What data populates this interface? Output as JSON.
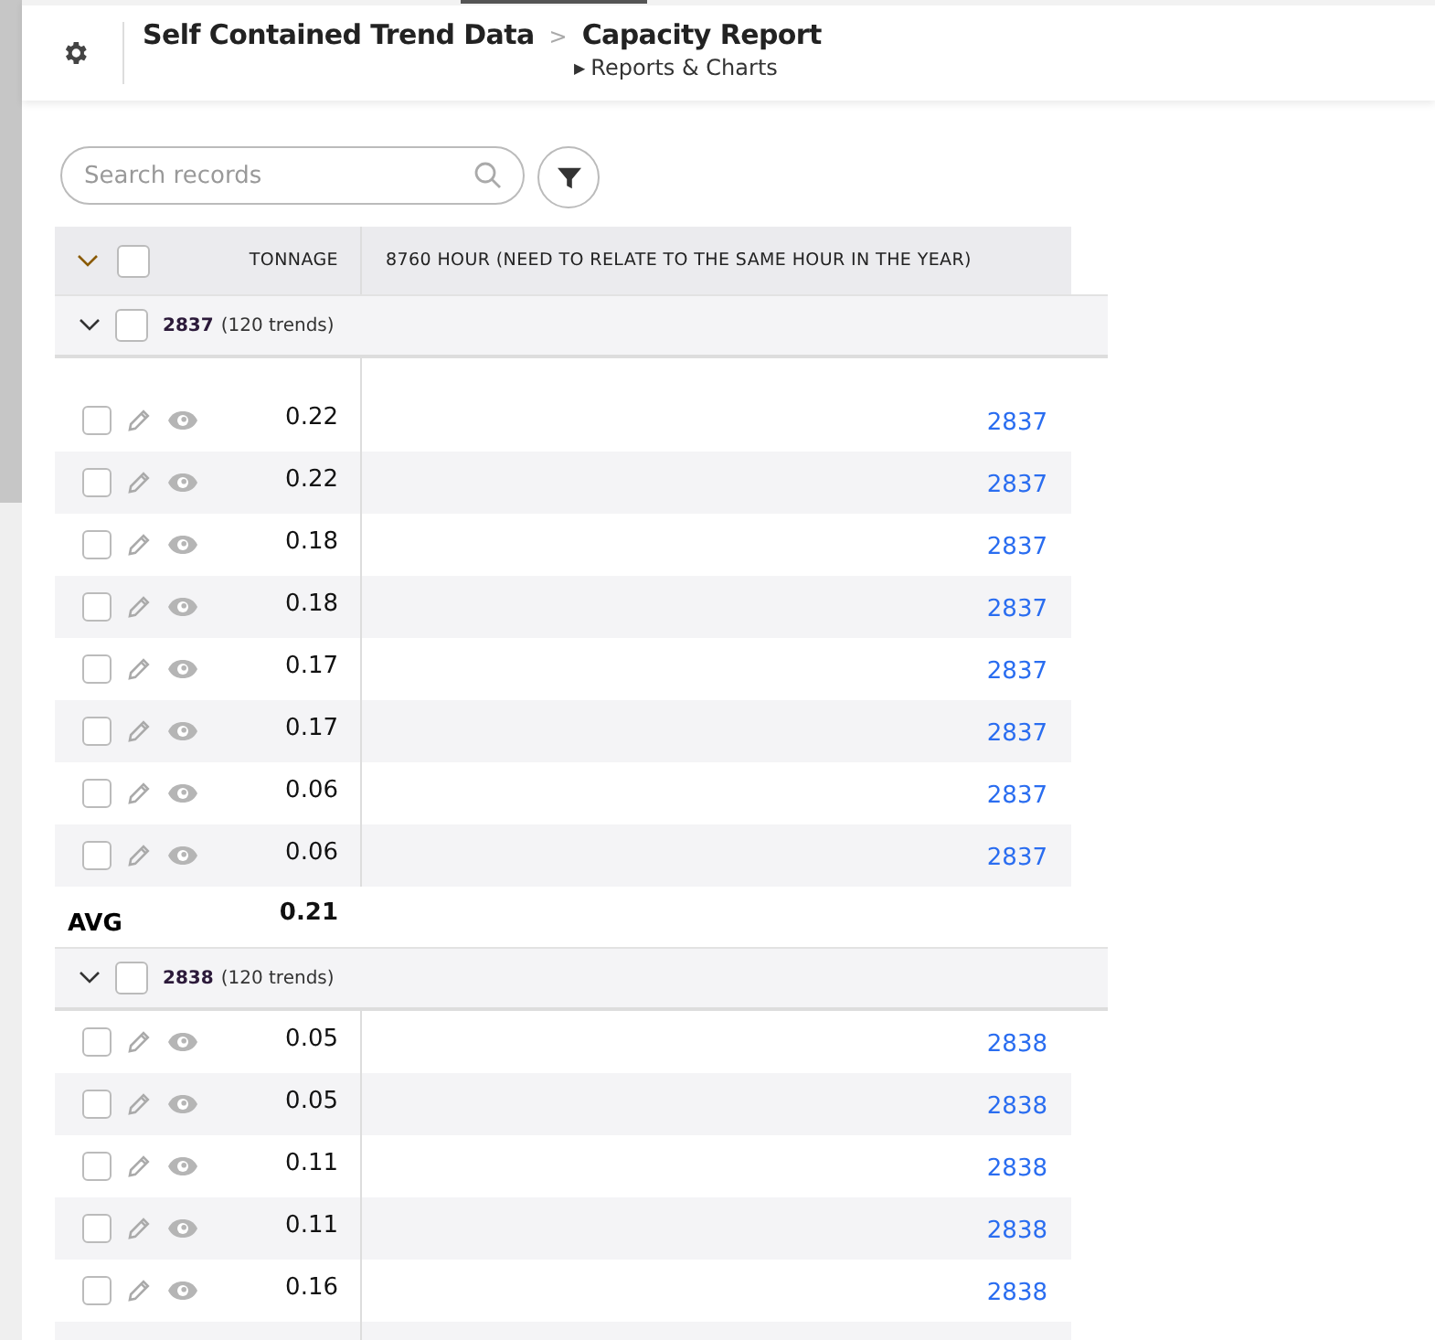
{
  "header": {
    "breadcrumb": [
      {
        "label": "Self Contained Trend Data",
        "separator": ">"
      },
      {
        "label": "Capacity Report"
      }
    ],
    "subtitle_icon": "▶",
    "subtitle": "Reports & Charts"
  },
  "search": {
    "placeholder": "Search records"
  },
  "table": {
    "select_all_checked": false,
    "columns": [
      "TONNAGE",
      "8760 HOUR (NEED TO RELATE TO THE SAME HOUR IN THE YEAR)"
    ],
    "groups": [
      {
        "name": "2837",
        "count": "(120 trends)",
        "expanded": true,
        "checked": false,
        "rows": [
          {
            "tonnage": "0.22",
            "hour": "2837",
            "checked": false
          },
          {
            "tonnage": "0.22",
            "hour": "2837",
            "checked": false
          },
          {
            "tonnage": "0.18",
            "hour": "2837",
            "checked": false
          },
          {
            "tonnage": "0.18",
            "hour": "2837",
            "checked": false
          },
          {
            "tonnage": "0.17",
            "hour": "2837",
            "checked": false
          },
          {
            "tonnage": "0.17",
            "hour": "2837",
            "checked": false
          },
          {
            "tonnage": "0.06",
            "hour": "2837",
            "checked": false
          },
          {
            "tonnage": "0.06",
            "hour": "2837",
            "checked": false
          }
        ],
        "summary": {
          "label": "AVG",
          "value": "0.21"
        }
      },
      {
        "name": "2838",
        "count": "(120 trends)",
        "expanded": true,
        "checked": false,
        "rows": [
          {
            "tonnage": "0.05",
            "hour": "2838",
            "checked": false
          },
          {
            "tonnage": "0.05",
            "hour": "2838",
            "checked": false
          },
          {
            "tonnage": "0.11",
            "hour": "2838",
            "checked": false
          },
          {
            "tonnage": "0.11",
            "hour": "2838",
            "checked": false
          },
          {
            "tonnage": "0.16",
            "hour": "2838",
            "checked": false
          }
        ]
      }
    ]
  }
}
